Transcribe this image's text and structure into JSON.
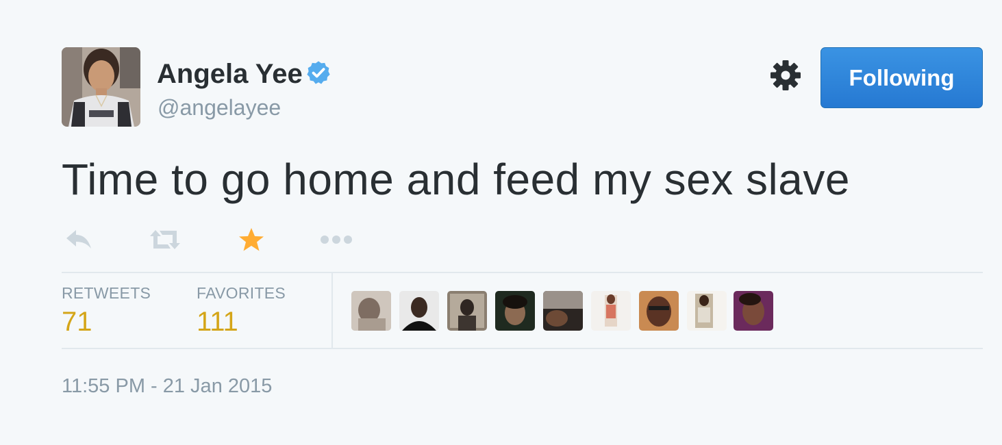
{
  "user": {
    "name": "Angela Yee",
    "handle": "@angelayee",
    "verified": true,
    "avatar_icon": "user-avatar"
  },
  "follow_button": {
    "label": "Following"
  },
  "settings_icon": "gear-icon",
  "tweet": {
    "text": "Time to go home and feed my sex slave"
  },
  "actions": [
    {
      "name": "reply",
      "icon": "reply-icon",
      "color": "#ccd6dd"
    },
    {
      "name": "retweet",
      "icon": "retweet-icon",
      "color": "#ccd6dd"
    },
    {
      "name": "favorite",
      "icon": "star-icon",
      "color": "#ffac33",
      "active": true
    },
    {
      "name": "more",
      "icon": "more-icon",
      "color": "#ccd6dd"
    }
  ],
  "stats": {
    "retweets_label": "RETWEETS",
    "retweets_count": "71",
    "favorites_label": "FAVORITES",
    "favorites_count": "111"
  },
  "favoriters": [
    {
      "icon": "user-avatar"
    },
    {
      "icon": "user-avatar"
    },
    {
      "icon": "user-avatar"
    },
    {
      "icon": "user-avatar"
    },
    {
      "icon": "user-avatar"
    },
    {
      "icon": "user-avatar"
    },
    {
      "icon": "user-avatar"
    },
    {
      "icon": "user-avatar"
    },
    {
      "icon": "user-avatar"
    }
  ],
  "timestamp": "11:55 PM - 21 Jan 2015",
  "colors": {
    "accent": "#2679d2",
    "verified_badge": "#55acee",
    "stat_value": "#d4a518",
    "muted": "#8899a6",
    "text": "#292f33",
    "background": "#f5f8fa"
  }
}
